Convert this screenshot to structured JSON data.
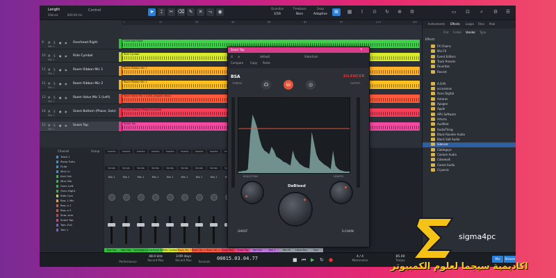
{
  "toolbar": {
    "song_label": "Length",
    "song_sub": "Silence",
    "sample_rate": "840.00 ms",
    "section": "Control",
    "quantize_label": "Quantize",
    "quantize_value": "1/16",
    "timebase_label": "Timebase",
    "timebase_value": "Bars",
    "snap_label": "Snap",
    "snap_value": "Adaptive"
  },
  "tracks": [
    {
      "num": "9",
      "name": "Overhead Right",
      "sub": "Mix 1",
      "color": "#2fbf3a"
    },
    {
      "num": "10",
      "name": "Ride Cymbal",
      "sub": "Mix 1",
      "color": "#c5d82a"
    },
    {
      "num": "11",
      "name": "Room Ribbon Mic 1",
      "sub": "Mix 1",
      "color": "#f2a227"
    },
    {
      "num": "12",
      "name": "Room Ribbon Mic 2",
      "sub": "Mix 1",
      "color": "#f5b81c"
    },
    {
      "num": "13",
      "name": "Room Valve Mic 1 (Left)",
      "sub": "Mix 1",
      "color": "#ef4b3a"
    },
    {
      "num": "14",
      "name": "Snare Bottom (Phase, Solo)",
      "sub": "Mix 1",
      "color": "#e2354a"
    },
    {
      "num": "15",
      "name": "Snare Top",
      "sub": "Mix 1",
      "color": "#e33a8f"
    }
  ],
  "clips": [
    {
      "name": "Overhead Right",
      "color": "#3fd04a"
    },
    {
      "name": "Ride Cymbal",
      "color": "#d7ea2b"
    },
    {
      "name": "Room Ribbon Mic 1",
      "color": "#ffb12c"
    },
    {
      "name": "Room Ribbon Mic 2",
      "color": "#ffc11f"
    },
    {
      "name": "Room Valve Mic 1 (Left) (slipped delay)",
      "color": "#ff5a3c"
    },
    {
      "name": "Snare Bottom (Phase Inverted)",
      "color": "#f43f5a"
    },
    {
      "name": "Snare Top",
      "color": "#f24aa0"
    }
  ],
  "ruler": [
    "1",
    "17",
    "33",
    "49",
    "65",
    "81",
    "97",
    "113",
    "129"
  ],
  "browser": {
    "tabs": [
      "Instruments",
      "Effects",
      "Loops",
      "Files",
      "Pool"
    ],
    "subtabs": [
      "Flat",
      "Folder",
      "Vendor",
      "Type"
    ],
    "head": "Effects",
    "items": [
      "FX Chains",
      "Mix FX",
      "Event Editors",
      "Track Presets",
      "Favorites",
      "Recent",
      "A.O.M.",
      "accusonus",
      "Acon Digital",
      "Antares",
      "Apogee",
      "Apple",
      "APU Software",
      "Arturia",
      "Audified",
      "AudioThing",
      "Black Rooster Audio",
      "Black Salt Audio",
      "Silencer",
      "Cableguys",
      "Caelum Audio",
      "Cakewalk",
      "Camel Audio",
      "Crysonic"
    ],
    "selected_index": 18
  },
  "mixer": {
    "header": {
      "channel": "Channel",
      "group": "Group"
    },
    "channels": [
      {
        "name": "Track 1",
        "color": "#3a8fd9"
      },
      {
        "name": "Piano Tuttu",
        "color": "#3a8fd9"
      },
      {
        "name": "Flute",
        "color": "#3a8fd9"
      },
      {
        "name": "Mix1 In",
        "color": "#3a8fd9"
      },
      {
        "name": "Kick Out",
        "color": "#2fbf3a"
      },
      {
        "name": "Mix1 Mic",
        "color": "#2fbf3a"
      },
      {
        "name": "Over..Left",
        "color": "#2fbf3a"
      },
      {
        "name": "Over..Right",
        "color": "#2fbf3a"
      },
      {
        "name": "Ride Cym",
        "color": "#c5d82a"
      },
      {
        "name": "Roo..1 Mic",
        "color": "#f2a227"
      },
      {
        "name": "Roo..e 1",
        "color": "#ef4b3a"
      },
      {
        "name": "Roo..e 2",
        "color": "#ef4b3a"
      },
      {
        "name": "Snar..tom",
        "color": "#e2354a"
      },
      {
        "name": "Snare Top",
        "color": "#e33a8f"
      },
      {
        "name": "Tom..Full",
        "color": "#8a55d0"
      },
      {
        "name": "Tom 1",
        "color": "#8a55d0"
      }
    ],
    "strips": [
      {
        "label": "Kick Out",
        "color": "#2fbf3a",
        "io": "Mix 1"
      },
      {
        "label": "Mix1 Mic",
        "color": "#2fbf3a",
        "io": "Mix 1"
      },
      {
        "label": "Overhead Left",
        "color": "#2fbf3a",
        "io": "Mix 1"
      },
      {
        "label": "Overhead Right",
        "color": "#3fd04a",
        "io": "Mix 1"
      },
      {
        "label": "Ride Cymbal",
        "color": "#d7ea2b",
        "io": "Mix 1"
      },
      {
        "label": "Room Mic 1",
        "color": "#ffb12c",
        "io": "Mix 1"
      },
      {
        "label": "Room Val..e 1",
        "color": "#ff5a3c",
        "io": "Mix 1"
      },
      {
        "label": "Room Val..e 2",
        "color": "#ff5a3c",
        "io": "Mix 1"
      },
      {
        "label": "Snare Bot..",
        "color": "#f43f5a",
        "io": "Mix 1"
      },
      {
        "label": "Snare Top",
        "color": "#f24aa0",
        "io": "Mix 1"
      },
      {
        "label": "Tom Full",
        "color": "#c07be0",
        "io": "Mix 1"
      },
      {
        "label": "Tom 1",
        "color": "#c07be0",
        "io": "Mix 1"
      },
      {
        "label": "Mix FX",
        "color": "#9aa0aa",
        "io": "Analog 1+2"
      },
      {
        "label": "Listen Bus",
        "color": "#9aa0aa",
        "io": "Analog 1+2"
      },
      {
        "label": "Post",
        "color": "#9aa0aa",
        "io": "Main"
      }
    ],
    "inserts_label": "Inserts",
    "sends_label": "Sends"
  },
  "bottombar": {
    "performance_label": "Performance",
    "sample_rate": "48.0 kHz",
    "sample_rate_sub": "Record Max",
    "duration": "3:09 days",
    "duration_sub": "Record Max",
    "seconds": "Seconds",
    "time": "00015.03.04.77",
    "time_sub": "Bars",
    "signature": "4 / 4",
    "metronome": "Metronome",
    "tempo": "85.00",
    "tempo_label": "Tempo",
    "mix_button": "Mix",
    "browse_button": "Browse"
  },
  "plugin": {
    "title": "Snare Top",
    "preset": "default",
    "compare": "Compare",
    "copy": "Copy",
    "paste": "Paste",
    "sidechain": "Sidechain",
    "brand": "BSA",
    "product": "SILENCER",
    "threshold_label": "THRESH",
    "output_label": "OUTPUT",
    "reduction_label": "REDUCTION",
    "length_label": "LENGTH",
    "deblend": "DeBleed",
    "ghost": "GHOST",
    "schain": "S-CHAIN",
    "graph_values": [
      0.02,
      0.02,
      0.03,
      0.03,
      0.05,
      0.5,
      0.78,
      0.7,
      0.6,
      0.45,
      0.35,
      0.3,
      0.28,
      0.25,
      0.35,
      0.3,
      0.22,
      0.2,
      0.18,
      0.15,
      0.14,
      0.12,
      0.1,
      0.3,
      0.2,
      0.16,
      0.12,
      0.1,
      0.08,
      0.07,
      0.06,
      0.55,
      0.4,
      0.25,
      0.18,
      0.15,
      0.12,
      0.1,
      0.08,
      0.05,
      0.3,
      0.1,
      0.06,
      0.04,
      0.03,
      0.02,
      0.02,
      0.02
    ]
  },
  "watermark": {
    "site": "sigma4pc",
    "arabic": "اكاديمية سيجما لعلوم الكمبيوتر"
  },
  "colors": {
    "accent": "#2a7fd9",
    "plugin_accent": "#e2553a",
    "watermark_yellow": "#f5d016"
  }
}
